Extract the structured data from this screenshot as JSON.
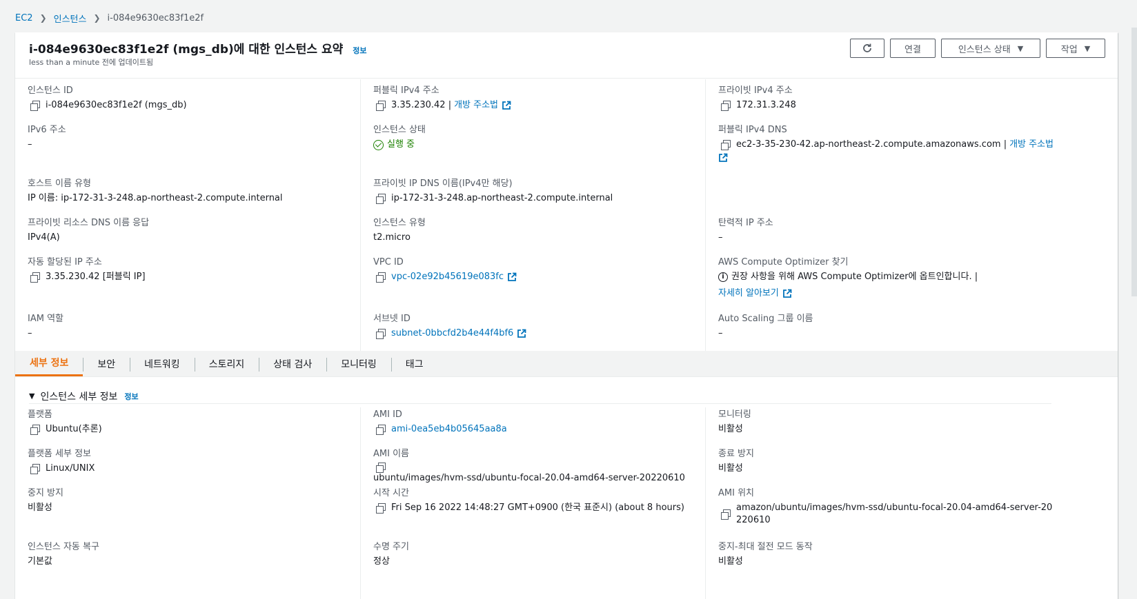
{
  "breadcrumb": {
    "items": [
      "EC2",
      "인스턴스"
    ],
    "current": "i-084e9630ec83f1e2f"
  },
  "header": {
    "title": "i-084e9630ec83f1e2f (mgs_db)에 대한 인스턴스 요약",
    "info": "정보",
    "subtitle": "less than a minute 전에 업데이트됨",
    "buttons": {
      "refresh_icon": "refresh-icon",
      "connect": "연결",
      "instance_state": "인스턴스 상태",
      "actions": "작업"
    }
  },
  "summary": {
    "instance_id": {
      "label": "인스턴스 ID",
      "value": "i-084e9630ec83f1e2f (mgs_db)"
    },
    "ipv6": {
      "label": "IPv6 주소",
      "value": "–"
    },
    "hostname_type": {
      "label": "호스트 이름 유형",
      "value": "IP 이름: ip-172-31-3-248.ap-northeast-2.compute.internal"
    },
    "private_dns_answer": {
      "label": "프라이빗 리소스 DNS 이름 응답",
      "value": "IPv4(A)"
    },
    "auto_ip": {
      "label": "자동 할당된 IP 주소",
      "value": "3.35.230.42 [퍼블릭 IP]"
    },
    "iam_role": {
      "label": "IAM 역할",
      "value": "–"
    },
    "public_ipv4": {
      "label": "퍼블릭 IPv4 주소",
      "value": "3.35.230.42 |",
      "link": "개방 주소법"
    },
    "instance_state": {
      "label": "인스턴스 상태",
      "value": "실행 중"
    },
    "private_ip_dns": {
      "label": "프라이빗 IP DNS 이름(IPv4만 해당)",
      "value": "ip-172-31-3-248.ap-northeast-2.compute.internal"
    },
    "instance_type": {
      "label": "인스턴스 유형",
      "value": "t2.micro"
    },
    "vpc_id": {
      "label": "VPC ID",
      "value": "vpc-02e92b45619e083fc"
    },
    "subnet_id": {
      "label": "서브넷 ID",
      "value": "subnet-0bbcfd2b4e44f4bf6"
    },
    "private_ipv4": {
      "label": "프라이빗 IPv4 주소",
      "value": "172.31.3.248"
    },
    "public_dns": {
      "label": "퍼블릭 IPv4 DNS",
      "value": "ec2-3-35-230-42.ap-northeast-2.compute.amazonaws.com |",
      "link": "개방 주소법"
    },
    "elastic_ip": {
      "label": "탄력적 IP 주소",
      "value": "–"
    },
    "optimizer": {
      "label": "AWS Compute Optimizer 찾기",
      "value": "권장 사항을 위해 AWS Compute Optimizer에 옵트인합니다. |",
      "link": "자세히 알아보기"
    },
    "asg_name": {
      "label": "Auto Scaling 그룹 이름",
      "value": "–"
    }
  },
  "tabs": [
    {
      "label": "세부 정보",
      "active": true
    },
    {
      "label": "보안"
    },
    {
      "label": "네트워킹"
    },
    {
      "label": "스토리지"
    },
    {
      "label": "상태 검사"
    },
    {
      "label": "모니터링"
    },
    {
      "label": "태그"
    }
  ],
  "details": {
    "section_title": "인스턴스 세부 정보",
    "section_info": "정보",
    "platform": {
      "label": "플랫폼",
      "value": "Ubuntu(추론)"
    },
    "platform_details": {
      "label": "플랫폼 세부 정보",
      "value": "Linux/UNIX"
    },
    "stop_protection": {
      "label": "중지 방지",
      "value": "비활성"
    },
    "auto_recovery": {
      "label": "인스턴스 자동 복구",
      "value": "기본값"
    },
    "ami_id": {
      "label": "AMI ID",
      "value": "ami-0ea5eb4b05645aa8a"
    },
    "ami_name": {
      "label": "AMI 이름",
      "value": "ubuntu/images/hvm-ssd/ubuntu-focal-20.04-amd64-server-20220610"
    },
    "launch_time": {
      "label": "시작 시간",
      "value": "Fri Sep 16 2022 14:48:27 GMT+0900 (한국 표준시) (about 8 hours)"
    },
    "lifecycle": {
      "label": "수명 주기",
      "value": "정상"
    },
    "monitoring": {
      "label": "모니터링",
      "value": "비활성"
    },
    "termination_protection": {
      "label": "종료 방지",
      "value": "비활성"
    },
    "ami_location": {
      "label": "AMI 위치",
      "value": "amazon/ubuntu/images/hvm-ssd/ubuntu-focal-20.04-amd64-server-20220610"
    },
    "stop_hibernate": {
      "label": "중지-최대 절전 모드 동작",
      "value": "비활성"
    }
  },
  "colors": {
    "link": "#0073bb",
    "active_tab": "#ec7211",
    "running": "#1d8102"
  }
}
